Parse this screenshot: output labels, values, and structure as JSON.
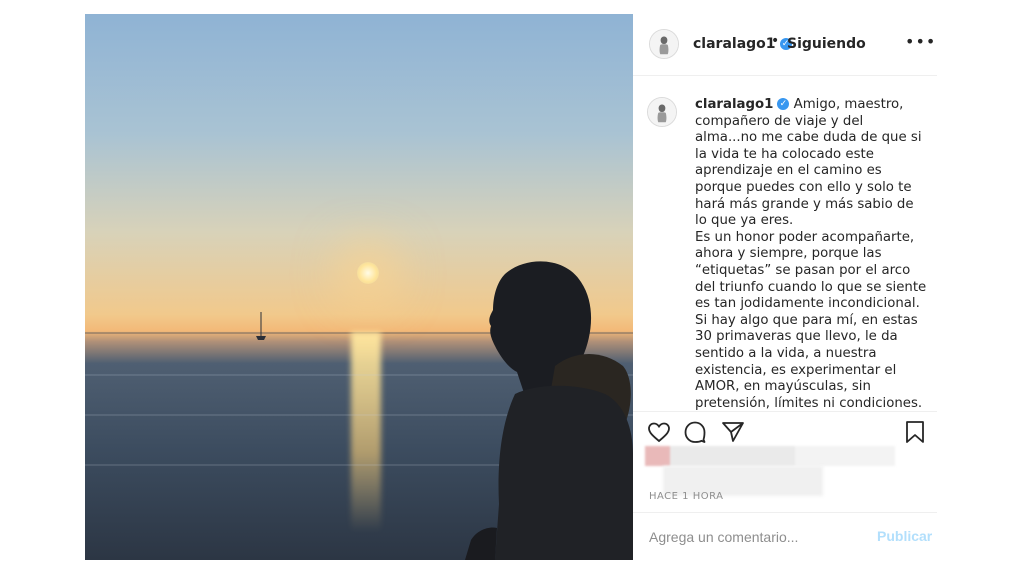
{
  "post": {
    "username": "claralago1",
    "follow_status": "Siguiendo",
    "caption": "Amigo, maestro, compañero de viaje y del alma...no me cabe duda de que si la vida te ha colocado este aprendizaje en el camino es porque puedes con ello y solo te hará más grande y más sabio de lo que ya eres.\nEs un honor poder acompañarte, ahora y siempre, porque las “etiquetas” se pasan por el arco del triunfo cuando lo que se siente es tan jodidamente incondicional.\nSi hay algo que para mí, en estas 30 primaveras que llevo, le da sentido a la vida, a nuestra existencia, es experimentar el AMOR, en mayúsculas, sin pretensión, límites ni condiciones.\nY ya te digo yo que el mío lo",
    "time": "HACE 1 HORA"
  },
  "comment": {
    "placeholder": "Agrega un comentario...",
    "publish_label": "Publicar"
  },
  "icons": {
    "verified": "verified-badge-icon",
    "more": "more-options-icon",
    "like": "heart-icon",
    "comment": "comment-bubble-icon",
    "share": "paper-plane-icon",
    "save": "bookmark-icon"
  },
  "colors": {
    "verified": "#3897f0",
    "publish_disabled": "#b2dffc",
    "text": "#262626",
    "muted": "#8e8e8e"
  }
}
